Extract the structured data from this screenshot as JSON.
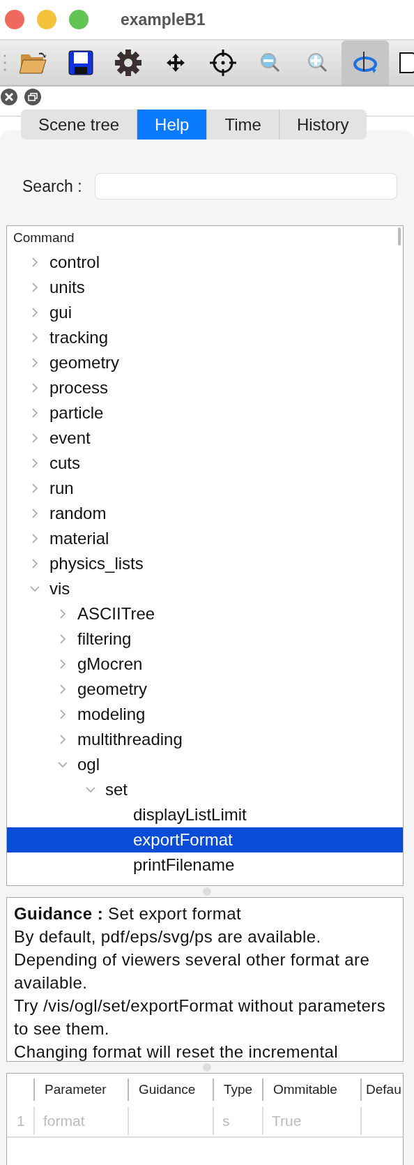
{
  "window": {
    "title": "exampleB1"
  },
  "toolbar": [
    {
      "kind": "open",
      "selected": false
    },
    {
      "kind": "save",
      "selected": false
    },
    {
      "kind": "settings",
      "selected": false
    },
    {
      "kind": "move",
      "selected": false
    },
    {
      "kind": "target",
      "selected": false
    },
    {
      "kind": "zoom-out",
      "selected": false
    },
    {
      "kind": "zoom-in",
      "selected": false
    },
    {
      "kind": "rotate",
      "selected": true
    },
    {
      "kind": "shape",
      "selected": false
    }
  ],
  "tabs": [
    {
      "label": "Scene tree",
      "selected": false
    },
    {
      "label": "Help",
      "selected": true
    },
    {
      "label": "Time",
      "selected": false
    },
    {
      "label": "History",
      "selected": false
    }
  ],
  "search": {
    "label": "Search :"
  },
  "tree": {
    "header": "Command",
    "items": [
      {
        "label": "control",
        "expanded": false,
        "selected": false
      },
      {
        "label": "units",
        "expanded": false,
        "selected": false
      },
      {
        "label": "gui",
        "expanded": false,
        "selected": false
      },
      {
        "label": "tracking",
        "expanded": false,
        "selected": false
      },
      {
        "label": "geometry",
        "expanded": false,
        "selected": false
      },
      {
        "label": "process",
        "expanded": false,
        "selected": false
      },
      {
        "label": "particle",
        "expanded": false,
        "selected": false
      },
      {
        "label": "event",
        "expanded": false,
        "selected": false
      },
      {
        "label": "cuts",
        "expanded": false,
        "selected": false
      },
      {
        "label": "run",
        "expanded": false,
        "selected": false
      },
      {
        "label": "random",
        "expanded": false,
        "selected": false
      },
      {
        "label": "material",
        "expanded": false,
        "selected": false
      },
      {
        "label": "physics_lists",
        "expanded": false,
        "selected": false
      },
      {
        "label": "vis",
        "expanded": true,
        "selected": false,
        "children": [
          {
            "label": "ASCIITree",
            "expanded": false,
            "selected": false
          },
          {
            "label": "filtering",
            "expanded": false,
            "selected": false
          },
          {
            "label": "gMocren",
            "expanded": false,
            "selected": false
          },
          {
            "label": "geometry",
            "expanded": false,
            "selected": false
          },
          {
            "label": "modeling",
            "expanded": false,
            "selected": false
          },
          {
            "label": "multithreading",
            "expanded": false,
            "selected": false
          },
          {
            "label": "ogl",
            "expanded": true,
            "selected": false,
            "children": [
              {
                "label": "set",
                "expanded": true,
                "selected": false,
                "children": [
                  {
                    "label": "displayListLimit",
                    "kind": "leaf",
                    "selected": false
                  },
                  {
                    "label": "exportFormat",
                    "kind": "leaf",
                    "selected": true
                  },
                  {
                    "label": "printFilename",
                    "kind": "leaf",
                    "selected": false
                  }
                ]
              }
            ]
          }
        ]
      }
    ]
  },
  "guidance": {
    "lines": [
      "**Guidance :** Set export format",
      "By default, pdf/eps/svg/ps are available.",
      "Depending of viewers several other format are available.",
      "Try /vis/ogl/set/exportFormat without parameters to see them.",
      "Changing format will reset the incremental"
    ]
  },
  "parameters": {
    "columns": [
      "Parameter",
      "Guidance",
      "Type",
      "Ommitable",
      "Defau"
    ],
    "rows": [
      {
        "index": "1",
        "cells": [
          "format",
          "",
          "s",
          "True",
          ""
        ]
      }
    ]
  }
}
